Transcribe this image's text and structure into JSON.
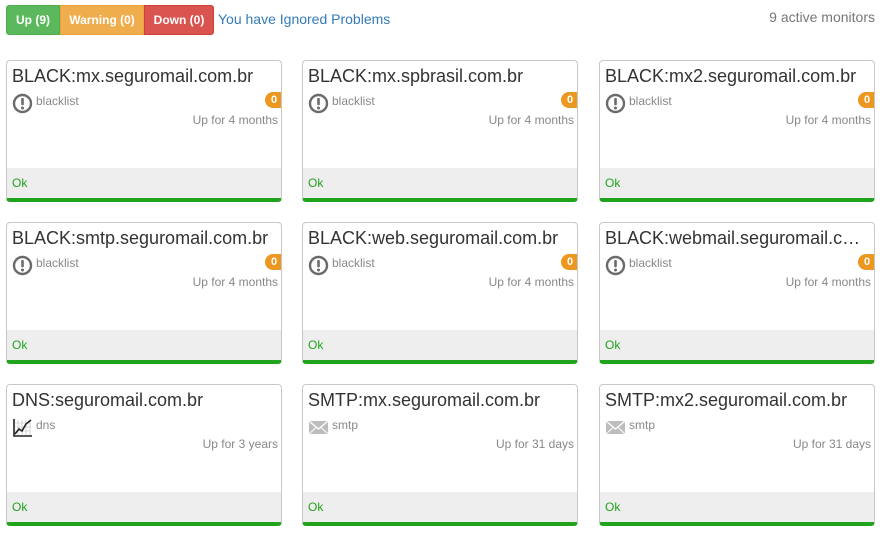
{
  "filters": {
    "up_label": "Up (9)",
    "warning_label": "Warning (0)",
    "down_label": "Down (0)"
  },
  "ignored_link": "You have Ignored Problems",
  "active_monitors": "9 active monitors",
  "colors": {
    "up": "#5cb85c",
    "warning": "#f0ad4e",
    "down": "#d9534f",
    "link": "#337ab7",
    "ok_green": "#21a31d",
    "badge": "#ec971f"
  },
  "monitors": [
    {
      "name": "BLACK:mx.seguromail.com.br",
      "type": "blacklist",
      "icon": "exclamation-circle-icon",
      "badge": "0",
      "uptime": "Up for 4 months",
      "status": "Ok"
    },
    {
      "name": "BLACK:mx.spbrasil.com.br",
      "type": "blacklist",
      "icon": "exclamation-circle-icon",
      "badge": "0",
      "uptime": "Up for 4 months",
      "status": "Ok"
    },
    {
      "name": "BLACK:mx2.seguromail.com.br",
      "type": "blacklist",
      "icon": "exclamation-circle-icon",
      "badge": "0",
      "uptime": "Up for 4 months",
      "status": "Ok"
    },
    {
      "name": "BLACK:smtp.seguromail.com.br",
      "type": "blacklist",
      "icon": "exclamation-circle-icon",
      "badge": "0",
      "uptime": "Up for 4 months",
      "status": "Ok"
    },
    {
      "name": "BLACK:web.seguromail.com.br",
      "type": "blacklist",
      "icon": "exclamation-circle-icon",
      "badge": "0",
      "uptime": "Up for 4 months",
      "status": "Ok"
    },
    {
      "name": "BLACK:webmail.seguromail.com.br",
      "type": "blacklist",
      "icon": "exclamation-circle-icon",
      "badge": "0",
      "uptime": "Up for 4 months",
      "status": "Ok"
    },
    {
      "name": "DNS:seguromail.com.br",
      "type": "dns",
      "icon": "line-chart-icon",
      "badge": "",
      "uptime": "Up for 3 years",
      "status": "Ok"
    },
    {
      "name": "SMTP:mx.seguromail.com.br",
      "type": "smtp",
      "icon": "envelope-icon",
      "badge": "",
      "uptime": "Up for 31 days",
      "status": "Ok"
    },
    {
      "name": "SMTP:mx2.seguromail.com.br",
      "type": "smtp",
      "icon": "envelope-icon",
      "badge": "",
      "uptime": "Up for 31 days",
      "status": "Ok"
    }
  ]
}
